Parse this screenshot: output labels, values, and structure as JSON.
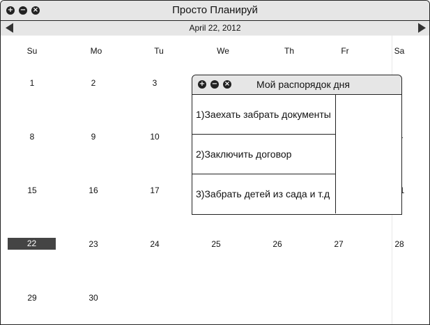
{
  "app": {
    "title": "Просто Планируй",
    "controls": [
      "plus-icon",
      "minus-icon",
      "close-icon"
    ]
  },
  "calendar": {
    "date_label": "April 22, 2012",
    "weekdays": [
      "Su",
      "Mo",
      "Tu",
      "We",
      "Th",
      "Fr",
      "Sa"
    ],
    "weeks": [
      [
        "1",
        "2",
        "3",
        "",
        "",
        "",
        ""
      ],
      [
        "8",
        "9",
        "10",
        "",
        "",
        "",
        "4"
      ],
      [
        "15",
        "16",
        "17",
        "",
        "",
        "",
        "1"
      ],
      [
        "22",
        "23",
        "24",
        "25",
        "26",
        "27",
        "28"
      ],
      [
        "29",
        "30",
        "",
        "",
        "",
        "",
        ""
      ]
    ],
    "selected_day": "22"
  },
  "popup": {
    "title": "Мой распорядок дня",
    "tasks": [
      "1)Заехать забрать документы",
      "2)Заключить договор",
      "3)Забрать детей из сада и т.д"
    ]
  },
  "colors": {
    "chrome": "#e6e6e6",
    "border": "#222222",
    "today_bg": "#444444"
  }
}
